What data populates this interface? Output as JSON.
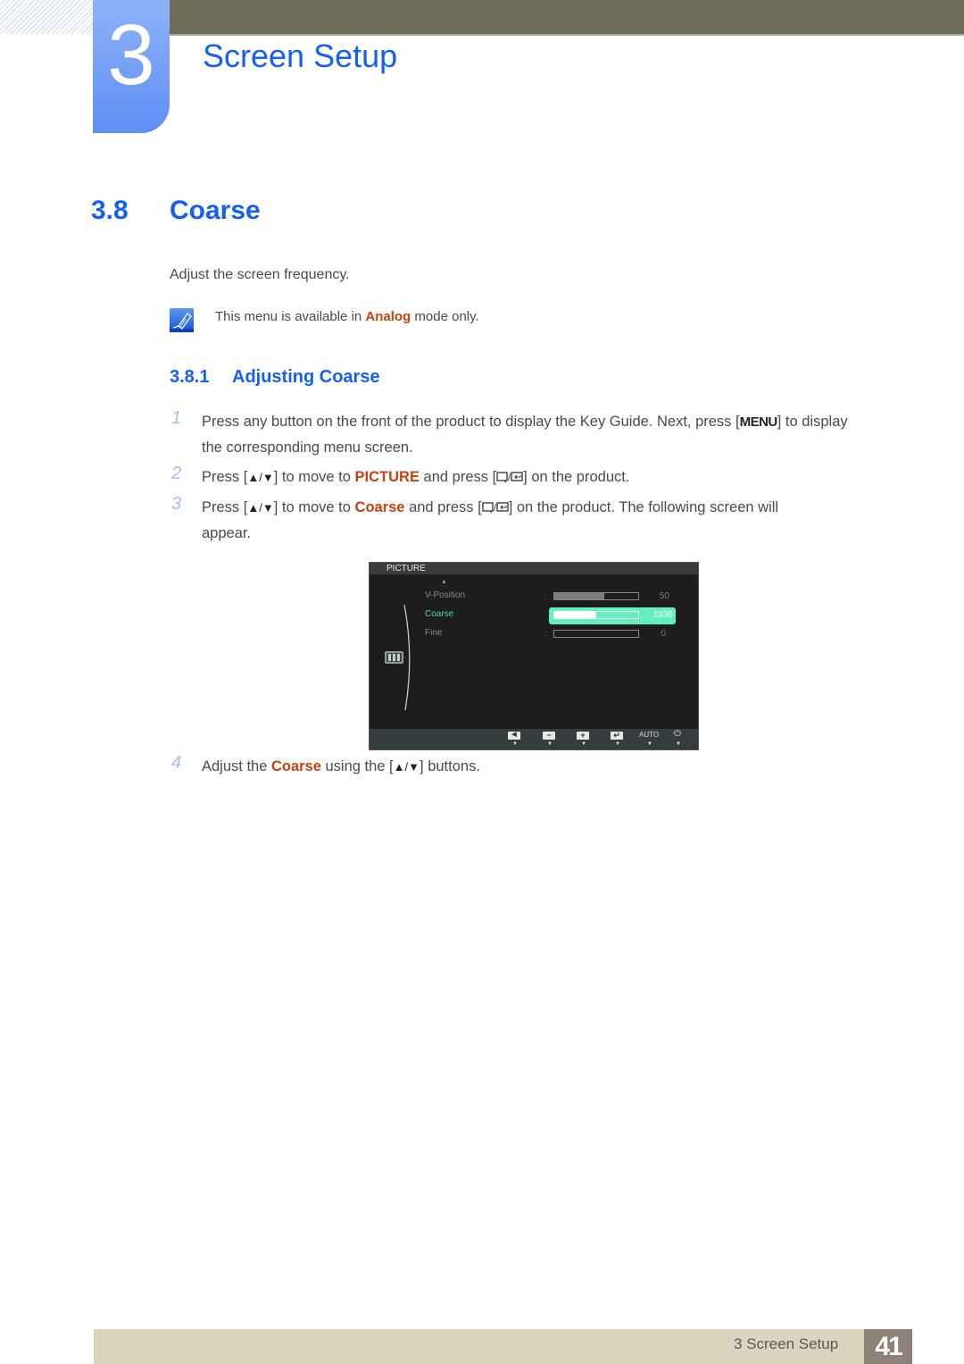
{
  "header": {
    "chapter_number": "3",
    "chapter_title": "Screen Setup"
  },
  "section": {
    "number": "3.8",
    "title": "Coarse",
    "intro": "Adjust the screen frequency.",
    "note": {
      "icon": "note-pencil-icon",
      "prefix": "This menu is available in ",
      "highlight": "Analog",
      "suffix": " mode only."
    }
  },
  "subsection": {
    "number": "3.8.1",
    "title": "Adjusting Coarse"
  },
  "steps": [
    {
      "number": "1",
      "line1_a": "Press any button on the front of the product to display the Key Guide. Next, press [",
      "menu_key": "MENU",
      "line1_b": "] to display",
      "line2": "the corresponding menu screen."
    },
    {
      "number": "2",
      "a": "Press [",
      "up": "▲",
      "slash": "/",
      "down": "▼",
      "b": "] to move to ",
      "highlight": "PICTURE",
      "c": " and press [",
      "d": "] on the product."
    },
    {
      "number": "3",
      "a": "Press [",
      "up": "▲",
      "slash": "/",
      "down": "▼",
      "b": "] to move to ",
      "highlight": "Coarse",
      "c": " and press [",
      "d": "] on the product. The following screen will",
      "line2": "appear."
    },
    {
      "number": "4",
      "a": "Adjust the ",
      "highlight": "Coarse",
      "b": " using the [",
      "up": "▲",
      "slash": "/",
      "down": "▼",
      "c": "] buttons."
    }
  ],
  "osd": {
    "menu_title": "PICTURE",
    "items": [
      {
        "label": "V-Position",
        "value": "50",
        "fill": 0.6,
        "active": false
      },
      {
        "label": "Coarse",
        "value": "1936",
        "fill": 0.5,
        "active": true
      },
      {
        "label": "Fine",
        "value": "0",
        "fill": 0.0,
        "active": false
      }
    ],
    "footer_buttons": [
      {
        "icon": "left-arrow-icon",
        "glyph": "◀"
      },
      {
        "icon": "minus-icon",
        "glyph": "−"
      },
      {
        "icon": "plus-icon",
        "glyph": "+"
      },
      {
        "icon": "enter-icon",
        "glyph": "↵"
      },
      {
        "icon": "auto-label",
        "label": "AUTO"
      },
      {
        "icon": "power-icon",
        "glyph": "⏻"
      }
    ]
  },
  "colors": {
    "heading_blue": "#1560f4",
    "highlight_orange": "#c4420e",
    "osd_active": "#62f0c0"
  },
  "footer": {
    "chapter_label": "3 Screen Setup",
    "page_number": "41"
  }
}
